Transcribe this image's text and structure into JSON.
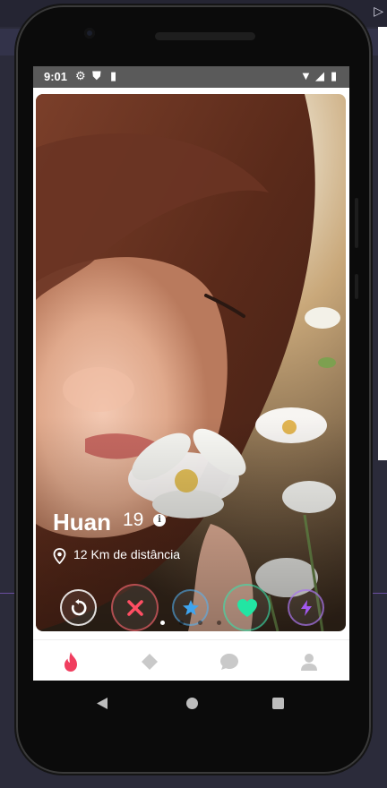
{
  "status_bar": {
    "time": "9:01"
  },
  "profile": {
    "name": "Huan",
    "age": "19",
    "distance": "12 Km de distância",
    "photo_count": 4,
    "current_photo": 1
  },
  "actions": [
    {
      "name": "rewind",
      "color": "#ffffff",
      "icon": "rewind-icon"
    },
    {
      "name": "nope",
      "color": "#ff4e63",
      "icon": "close-icon"
    },
    {
      "name": "super-like",
      "color": "#3ea4ef",
      "icon": "star-icon"
    },
    {
      "name": "like",
      "color": "#22e5a3",
      "icon": "heart-icon"
    },
    {
      "name": "boost",
      "color": "#a259f0",
      "icon": "lightning-icon"
    }
  ],
  "tabs": [
    {
      "name": "discover",
      "icon": "flame-icon",
      "active": true,
      "color": "#f03e5f"
    },
    {
      "name": "explore",
      "icon": "diamond-icon",
      "active": false,
      "color": "#c9c9c9"
    },
    {
      "name": "messages",
      "icon": "chat-icon",
      "active": false,
      "color": "#c9c9c9"
    },
    {
      "name": "profile",
      "icon": "user-icon",
      "active": false,
      "color": "#c9c9c9"
    }
  ]
}
